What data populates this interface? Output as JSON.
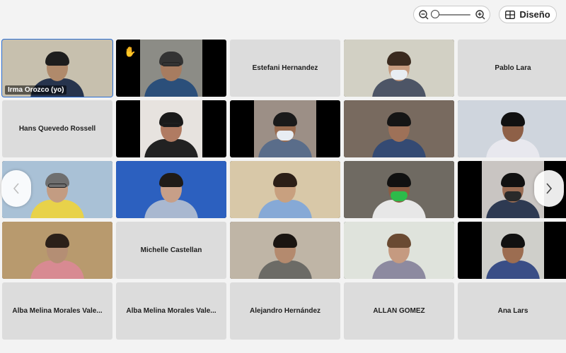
{
  "toolbar": {
    "zoom_level": 0.0,
    "layout_label": "Diseño"
  },
  "tiles": [
    {
      "name": "Irma Orozco (yo)",
      "kind": "video",
      "label_visible": true,
      "selected": true,
      "bg": "#c7c0ae",
      "skin": "#b08a6b",
      "shirt": "#27344d",
      "hair": "#1d1d1d",
      "frame": "full",
      "mask": false,
      "glasses": false,
      "hand": false
    },
    {
      "name": "",
      "kind": "video",
      "label_visible": false,
      "selected": false,
      "bg": "#8c8c86",
      "skin": "#a77c60",
      "shirt": "#2b4f7a",
      "hair": "#333",
      "frame": "center",
      "mask": false,
      "glasses": true,
      "hand": true
    },
    {
      "name": "Estefani Hernandez",
      "kind": "name",
      "label_visible": false,
      "selected": false
    },
    {
      "name": "",
      "kind": "video",
      "label_visible": false,
      "selected": false,
      "bg": "#d2d0c4",
      "skin": "#c79c80",
      "shirt": "#4d5566",
      "hair": "#3a2a1f",
      "frame": "full",
      "mask": true,
      "glasses": false,
      "hand": false
    },
    {
      "name": "Pablo Lara",
      "kind": "name",
      "label_visible": false,
      "selected": false
    },
    {
      "name": "Hans Quevedo Rossell",
      "kind": "name",
      "label_visible": false,
      "selected": false
    },
    {
      "name": "",
      "kind": "video",
      "label_visible": false,
      "selected": false,
      "bg": "#e7e3df",
      "skin": "#b07b62",
      "shirt": "#222222",
      "hair": "#1a1a1a",
      "frame": "center",
      "mask": false,
      "glasses": true,
      "hand": false
    },
    {
      "name": "",
      "kind": "video",
      "label_visible": false,
      "selected": false,
      "bg": "#9c8f86",
      "skin": "#9a6c50",
      "shirt": "#5a6d8a",
      "hair": "#1a1a1a",
      "frame": "center",
      "mask": true,
      "glasses": false,
      "hand": false
    },
    {
      "name": "",
      "kind": "video",
      "label_visible": false,
      "selected": false,
      "bg": "#786a5f",
      "skin": "#9e7158",
      "shirt": "#344a73",
      "hair": "#151515",
      "frame": "full",
      "mask": false,
      "glasses": false,
      "hand": false
    },
    {
      "name": "",
      "kind": "video",
      "label_visible": false,
      "selected": false,
      "bg": "#cfd5dd",
      "skin": "#8e6047",
      "shirt": "#e8e8ee",
      "hair": "#111",
      "frame": "full",
      "mask": false,
      "glasses": false,
      "hand": false
    },
    {
      "name": "",
      "kind": "video",
      "label_visible": false,
      "selected": false,
      "bg": "#a9c1d6",
      "skin": "#c39c82",
      "shirt": "#e8d24a",
      "hair": "#6f6f6f",
      "frame": "full",
      "mask": false,
      "glasses": true,
      "hand": false
    },
    {
      "name": "",
      "kind": "video",
      "label_visible": false,
      "selected": false,
      "bg": "#2c60bf",
      "skin": "#c79f88",
      "shirt": "#a9b8d0",
      "hair": "#1f1b17",
      "frame": "full",
      "mask": false,
      "glasses": false,
      "hand": false
    },
    {
      "name": "",
      "kind": "video",
      "label_visible": false,
      "selected": false,
      "bg": "#d8c8a8",
      "skin": "#c8a07f",
      "shirt": "#86a9d6",
      "hair": "#2c1f17",
      "frame": "full",
      "mask": false,
      "glasses": false,
      "hand": false
    },
    {
      "name": "",
      "kind": "video",
      "label_visible": false,
      "selected": false,
      "bg": "#6f6a62",
      "skin": "#8c5e44",
      "shirt": "#e7e7e7",
      "hair": "#111",
      "frame": "full",
      "mask": true,
      "glasses": false,
      "hand": false
    },
    {
      "name": "",
      "kind": "video",
      "label_visible": false,
      "selected": false,
      "bg": "#c9c5c2",
      "skin": "#9a6c53",
      "shirt": "#2e3a52",
      "hair": "#111",
      "frame": "center",
      "mask": true,
      "glasses": false,
      "hand": false
    },
    {
      "name": "",
      "kind": "video",
      "label_visible": false,
      "selected": false,
      "bg": "#b89a6e",
      "skin": "#b48e74",
      "shirt": "#d88a92",
      "hair": "#2b2019",
      "frame": "full",
      "mask": false,
      "glasses": false,
      "hand": false
    },
    {
      "name": "Michelle Castellan",
      "kind": "name",
      "label_visible": false,
      "selected": false
    },
    {
      "name": "",
      "kind": "video",
      "label_visible": false,
      "selected": false,
      "bg": "#bfb5a6",
      "skin": "#b48a6e",
      "shirt": "#6c6b66",
      "hair": "#1a1511",
      "frame": "full",
      "mask": false,
      "glasses": false,
      "hand": false
    },
    {
      "name": "",
      "kind": "video",
      "label_visible": false,
      "selected": false,
      "bg": "#dfe3dc",
      "skin": "#c59a80",
      "shirt": "#8d8aa0",
      "hair": "#6a4a32",
      "frame": "full",
      "mask": false,
      "glasses": false,
      "hand": false
    },
    {
      "name": "",
      "kind": "video",
      "label_visible": false,
      "selected": false,
      "bg": "#cfcfca",
      "skin": "#9c6d51",
      "shirt": "#3a4e86",
      "hair": "#111",
      "frame": "center",
      "mask": false,
      "glasses": false,
      "hand": false
    },
    {
      "name": "Alba Melina Morales Vale...",
      "kind": "name",
      "label_visible": false,
      "selected": false
    },
    {
      "name": "Alba Melina Morales Vale...",
      "kind": "name",
      "label_visible": false,
      "selected": false
    },
    {
      "name": "Alejandro Hernández",
      "kind": "name",
      "label_visible": false,
      "selected": false
    },
    {
      "name": "ALLAN GOMEZ",
      "kind": "name",
      "label_visible": false,
      "selected": false
    },
    {
      "name": "Ana Lars",
      "kind": "name",
      "label_visible": false,
      "selected": false
    }
  ]
}
